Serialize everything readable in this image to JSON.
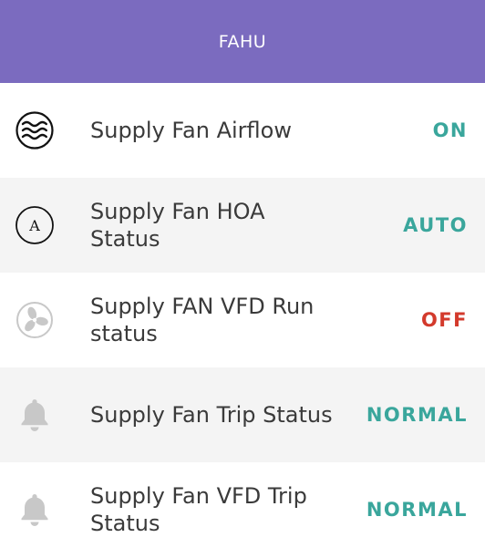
{
  "header": {
    "title": "FAHU"
  },
  "colors": {
    "header_bg": "#7b6bbf",
    "status_ok": "#3aa69c",
    "status_off": "#d33a2c"
  },
  "rows": [
    {
      "label": "Supply Fan Airflow",
      "status": "ON",
      "status_color": "#3aa69c",
      "icon": "airflow-waves-icon"
    },
    {
      "label": "Supply Fan HOA\nStatus",
      "status": "AUTO",
      "status_color": "#3aa69c",
      "icon": "letter-a-circle-icon"
    },
    {
      "label": "Supply FAN VFD Run\nstatus",
      "status": "OFF",
      "status_color": "#d33a2c",
      "icon": "fan-icon"
    },
    {
      "label": "Supply Fan Trip Status",
      "status": "NORMAL",
      "status_color": "#3aa69c",
      "icon": "bell-icon"
    },
    {
      "label": "Supply Fan VFD Trip\nStatus",
      "status": "NORMAL",
      "status_color": "#3aa69c",
      "icon": "bell-icon"
    }
  ]
}
